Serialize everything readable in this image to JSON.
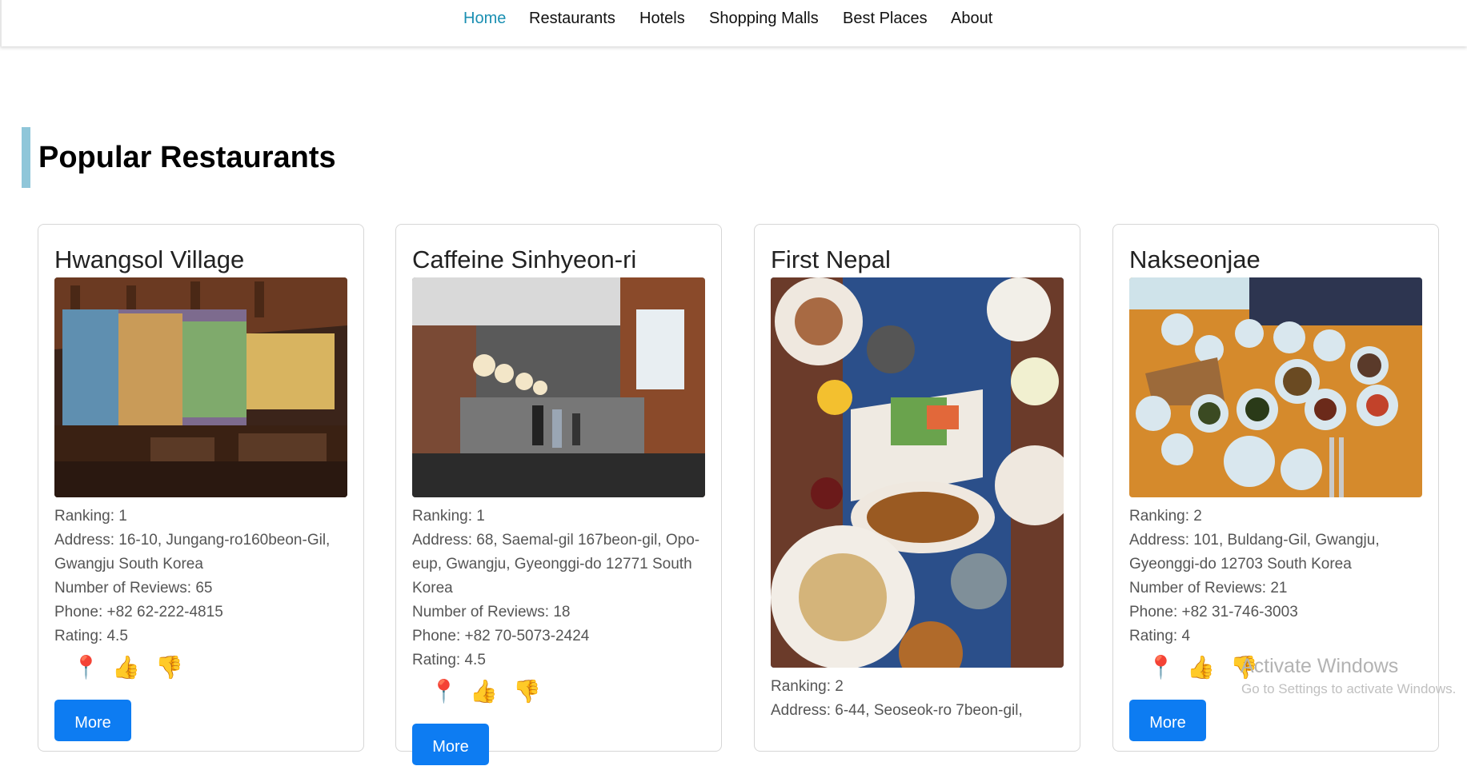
{
  "nav": {
    "items": [
      {
        "label": "Home",
        "active": true
      },
      {
        "label": "Restaurants",
        "active": false
      },
      {
        "label": "Hotels",
        "active": false
      },
      {
        "label": "Shopping Malls",
        "active": false
      },
      {
        "label": "Best Places",
        "active": false
      },
      {
        "label": "About",
        "active": false
      }
    ]
  },
  "section": {
    "title": "Popular Restaurants"
  },
  "restaurants": [
    {
      "name": "Hwangsol Village",
      "photo": "restaurant-interior-with-colorful-wall",
      "ranking": "Ranking: 1",
      "address": "Address: 16-10, Jungang-ro160beon-Gil, Gwangju South Korea",
      "reviews": "Number of Reviews: 65",
      "phone": "Phone: +82 62-222-4815",
      "rating": "Rating: 4.5",
      "more_label": "More"
    },
    {
      "name": "Caffeine Sinhyeon-ri",
      "photo": "cafe-interior-with-chandeliers",
      "ranking": "Ranking: 1",
      "address": "Address: 68, Saemal-gil 167beon-gil, Opo-eup, Gwangju, Gyeonggi-do 12771 South Korea",
      "reviews": "Number of Reviews: 18",
      "phone": "Phone: +82 70-5073-2424",
      "rating": "Rating: 4.5",
      "more_label": "More"
    },
    {
      "name": "First Nepal",
      "photo": "table-with-nepali-dishes",
      "ranking": "Ranking: 2",
      "address": "Address: 6-44, Seoseok-ro 7beon-gil,"
    },
    {
      "name": "Nakseonjae",
      "photo": "table-with-korean-side-dishes",
      "ranking": "Ranking: 2",
      "address": "Address: 101, Buldang-Gil, Gwangju, Gyeonggi-do 12703 South Korea",
      "reviews": "Number of Reviews: 21",
      "phone": "Phone: +82 31-746-3003",
      "rating": "Rating: 4",
      "more_label": "More"
    }
  ],
  "icons": {
    "location": "pin-icon",
    "like": "thumbs-up-icon",
    "dislike": "thumbs-down-icon"
  },
  "watermark": {
    "title": "Activate Windows",
    "subtitle": "Go to Settings to activate Windows."
  },
  "colors": {
    "accent": "#1a8fb2",
    "button": "#0d7cf2",
    "section_bar": "#8fc6d9"
  }
}
